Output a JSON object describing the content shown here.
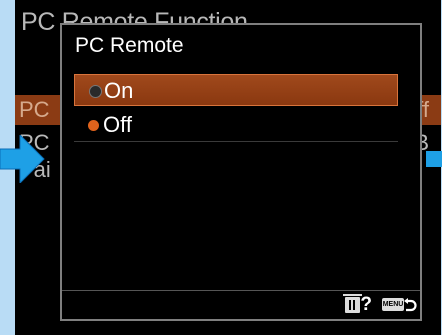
{
  "background_menu": {
    "title": "PC Remote Function",
    "rows": [
      {
        "left": "PC",
        "right": "Off",
        "highlighted": true
      },
      {
        "left": "PC",
        "right": "SB",
        "highlighted": false
      },
      {
        "left": "Pai",
        "right": "",
        "highlighted": false
      }
    ]
  },
  "dialog": {
    "title": "PC Remote",
    "options": [
      {
        "label": "On",
        "selected": true
      },
      {
        "label": "Off",
        "selected": false
      }
    ],
    "footer": {
      "help": "?",
      "menu": "MENU",
      "icons": [
        "trash-icon",
        "return-icon"
      ]
    }
  },
  "colors": {
    "frame": "#b9dcf5",
    "selection": "#9a4418",
    "option_dot": "#e0631c",
    "nav_arrow": "#1ea0e6"
  },
  "nav_arrows": [
    "arrow-left-icon",
    "arrow-right-icon"
  ]
}
